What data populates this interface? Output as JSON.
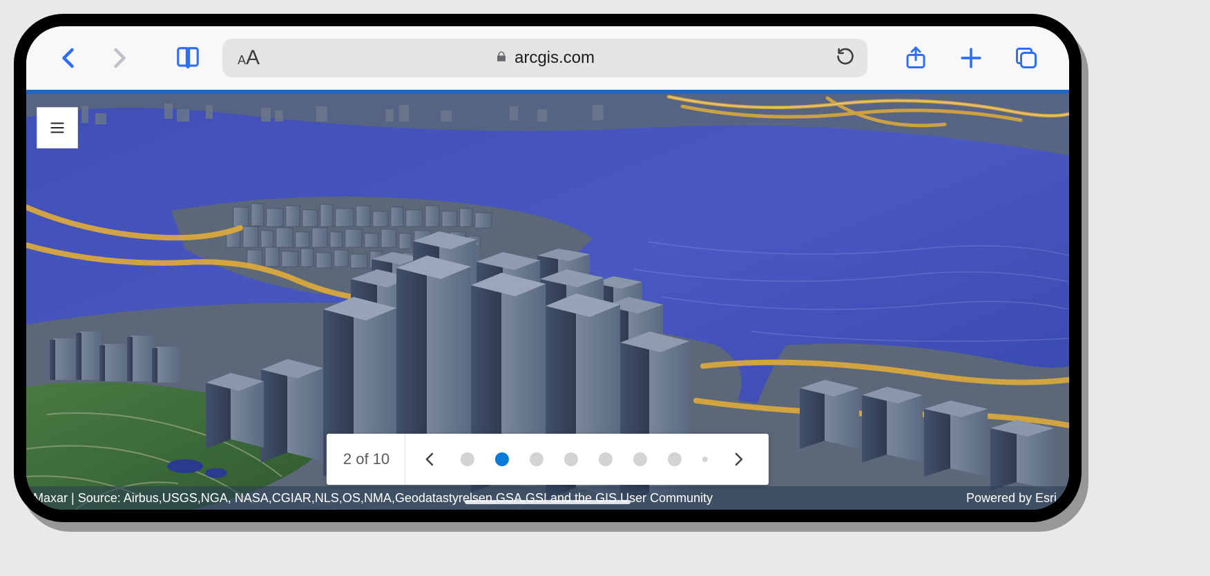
{
  "browser": {
    "domain": "arcgis.com",
    "icons": {
      "back": "chevron-left-icon",
      "forward": "chevron-right-icon",
      "bookmarks": "book-icon",
      "lock": "lock-icon",
      "refresh": "refresh-icon",
      "share": "share-icon",
      "newtab": "plus-icon",
      "tabs": "tabs-icon",
      "reader_small": "A",
      "reader_big": "A"
    },
    "colors": {
      "accent": "#0a7bd8",
      "safari_blue": "#2f6ef6",
      "disabled_gray": "#c0c0c4"
    }
  },
  "app": {
    "menu_icon": "hamburger-icon",
    "attribution_left": "Maxar | Source: Airbus,USGS,NGA, NASA,CGIAR,NLS,OS,NMA,Geodatastyrelsen,GSA,GSI and the GIS User Community",
    "attribution_right": "Powered by Esri"
  },
  "pager": {
    "current": 2,
    "total": 10,
    "label": "2 of 10",
    "active_index": 1
  },
  "map": {
    "description": "3D aerial city scene (downtown Boston) with extruded gray buildings, water/flood layer in blue, highways in yellow, parkland in green.",
    "colors": {
      "water": "#3f4fb5",
      "water_light": "#5a6ad0",
      "building": "#5b6a81",
      "building_dark": "#3d4a5e",
      "building_light": "#7f8ea4",
      "highway": "#d9a83d",
      "highway_light": "#f0cf7a",
      "park": "#3d6a3a",
      "park_light": "#5a8a4f",
      "ground": "#6a7685"
    }
  }
}
